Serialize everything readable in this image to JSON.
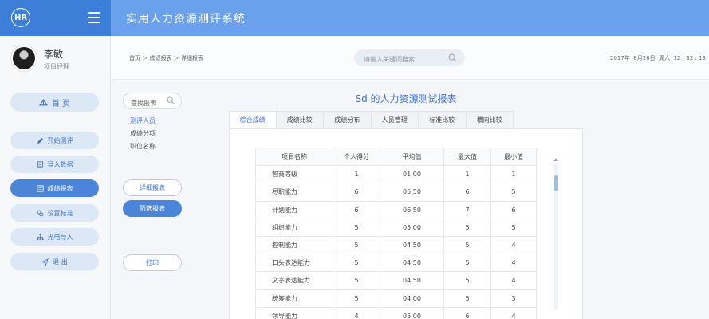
{
  "app": {
    "logo_text": "HR",
    "title": "实用人力资源测评系统"
  },
  "user": {
    "name": "李敏",
    "role": "项目经理"
  },
  "nav": {
    "home": "首 页",
    "items": [
      {
        "label": "开始测评",
        "icon": "pen-icon"
      },
      {
        "label": "导入数据",
        "icon": "upload-icon"
      },
      {
        "label": "成绩报表",
        "icon": "report-icon"
      },
      {
        "label": "设置标准",
        "icon": "link-icon"
      },
      {
        "label": "光电导入",
        "icon": "network-icon"
      },
      {
        "label": "退 出",
        "icon": "send-icon"
      }
    ]
  },
  "breadcrumb": "首页 ＞ 成绩报表 ＞ 详细报表",
  "search": {
    "placeholder": "请输入关键词搜索"
  },
  "datetime": "2017年  8月26日  周六  12 : 32 : 18",
  "subpanel": {
    "search_placeholder": "查找报表",
    "links": [
      "测评人员",
      "成绩分项",
      "职位名称"
    ],
    "detail_btn": "详细报表",
    "filter_btn": "筛选报表",
    "print_btn": "打印"
  },
  "report": {
    "title": "Sd  的人力资源测试报表",
    "tabs": [
      "综合成绩",
      "成绩比较",
      "成绩分布",
      "人员管理",
      "标准比较",
      "横向比较"
    ],
    "columns": [
      "项目名称",
      "个人得分",
      "平均值",
      "最大值",
      "最小值"
    ],
    "rows": [
      [
        "智商等级",
        "1",
        "01.00",
        "1",
        "1"
      ],
      [
        "尽职能力",
        "6",
        "05.50",
        "6",
        "5"
      ],
      [
        "计划能力",
        "6",
        "06.50",
        "7",
        "6"
      ],
      [
        "组织能力",
        "5",
        "05.00",
        "5",
        "5"
      ],
      [
        "控制能力",
        "5",
        "04.50",
        "5",
        "4"
      ],
      [
        "口头表达能力",
        "5",
        "04.50",
        "5",
        "4"
      ],
      [
        "文字表达能力",
        "5",
        "04.50",
        "5",
        "4"
      ],
      [
        "统筹能力",
        "5",
        "04.00",
        "5",
        "3"
      ],
      [
        "领导能力",
        "4",
        "05.00",
        "6",
        "4"
      ]
    ]
  },
  "colors": {
    "header_dark": "#3d7fd8",
    "header_light": "#69a1ec",
    "accent": "#4a85d9"
  }
}
